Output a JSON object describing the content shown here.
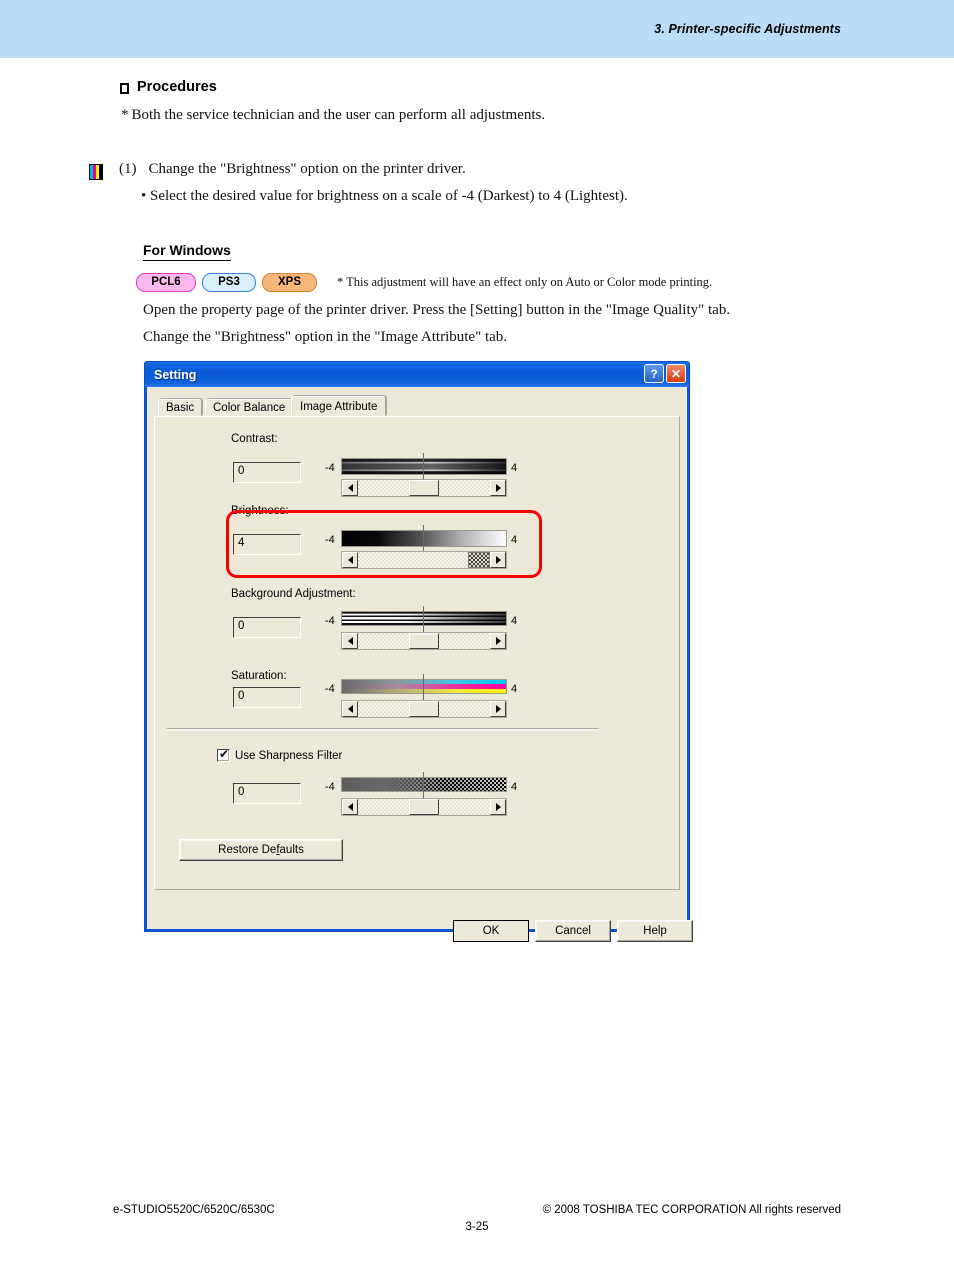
{
  "page": {
    "header_title": "3. Printer-specific Adjustments",
    "procedures_heading": "Procedures",
    "procedures_note_star": "*",
    "procedures_note": "Both the service technician and the user can perform all adjustments.",
    "step_number": "(1)",
    "step_text": "Change the \"Brightness\" option on the printer driver.",
    "step_bullet": "• Select the desired value for brightness on a scale of -4 (Darkest) to 4 (Lightest).",
    "for_windows": "For Windows",
    "badges": [
      {
        "label": "PCL6",
        "bg": "#fbb8ee",
        "border": "#e23fbd"
      },
      {
        "label": "PS3",
        "bg": "#d8f0fb",
        "border": "#3d7fd4"
      },
      {
        "label": "XPS",
        "bg": "#f7b77a",
        "border": "#d9802a"
      }
    ],
    "badge_note": "* This adjustment will have an effect only on Auto or Color mode printing.",
    "paragraph_1": "Open the property page of the printer driver.  Press the [Setting] button in the \"Image Quality\" tab.",
    "paragraph_2": "Change the \"Brightness\" option in the \"Image Attribute\" tab.",
    "accent_header_band": "#bddcf9",
    "highlight_color": "#ff0000"
  },
  "dialog": {
    "title": "Setting",
    "help_button": "?",
    "close_button": "✕",
    "tabs": [
      {
        "label": "Basic",
        "active": false
      },
      {
        "label": "Color Balance",
        "active": false
      },
      {
        "label": "Image Attribute",
        "active": true
      }
    ],
    "controls": [
      {
        "name": "contrast",
        "label": "Contrast:",
        "value": "0",
        "min_label": "-4",
        "max_label": "4",
        "thumb": "center"
      },
      {
        "name": "brightness",
        "label": "Brightness:",
        "value": "4",
        "min_label": "-4",
        "max_label": "4",
        "thumb": "right",
        "highlighted": true
      },
      {
        "name": "background",
        "label": "Background Adjustment:",
        "value": "0",
        "min_label": "-4",
        "max_label": "4",
        "thumb": "center"
      },
      {
        "name": "saturation",
        "label": "Saturation:",
        "value": "0",
        "min_label": "-4",
        "max_label": "4",
        "thumb": "center"
      },
      {
        "name": "sharpness",
        "label": "Use Sharpness Filter",
        "value": "0",
        "min_label": "-4",
        "max_label": "4",
        "thumb": "center",
        "checkbox": true,
        "checked": true
      }
    ],
    "restore_defaults": "Restore Defaults",
    "ok": "OK",
    "cancel": "Cancel",
    "help": "Help"
  },
  "footer": {
    "model": "e-STUDIO5520C/6520C/6530C",
    "copyright": "© 2008 TOSHIBA TEC CORPORATION All rights reserved",
    "page_number": "3-25"
  }
}
